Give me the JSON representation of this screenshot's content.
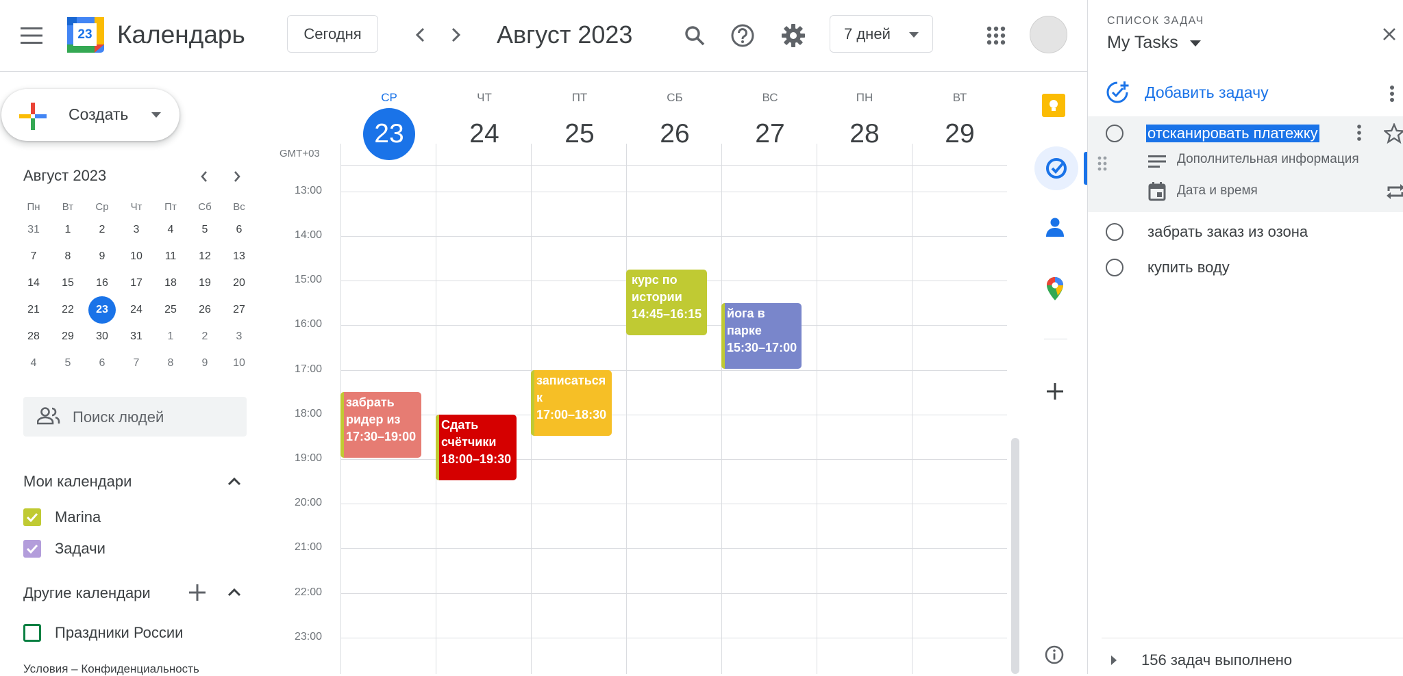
{
  "header": {
    "app_title": "Календарь",
    "logo_number": "23",
    "today_button": "Сегодня",
    "month_title": "Август 2023",
    "view_select": "7 дней"
  },
  "create_button": {
    "label": "Создать"
  },
  "mini_calendar": {
    "title": "Август 2023",
    "weekdays": [
      "Пн",
      "Вт",
      "Ср",
      "Чт",
      "Пт",
      "Сб",
      "Вс"
    ],
    "weeks": [
      [
        "31",
        "1",
        "2",
        "3",
        "4",
        "5",
        "6"
      ],
      [
        "7",
        "8",
        "9",
        "10",
        "11",
        "12",
        "13"
      ],
      [
        "14",
        "15",
        "16",
        "17",
        "18",
        "19",
        "20"
      ],
      [
        "21",
        "22",
        "23",
        "24",
        "25",
        "26",
        "27"
      ],
      [
        "28",
        "29",
        "30",
        "31",
        "1",
        "2",
        "3"
      ],
      [
        "4",
        "5",
        "6",
        "7",
        "8",
        "9",
        "10"
      ]
    ],
    "selected": "23"
  },
  "search_people": {
    "placeholder": "Поиск людей"
  },
  "my_calendars": {
    "title": "Мои календари",
    "items": [
      {
        "label": "Marina",
        "color": "#c0ca33"
      },
      {
        "label": "Задачи",
        "color": "#b39ddb"
      }
    ]
  },
  "other_calendars": {
    "title": "Другие календари",
    "items": [
      {
        "label": "Праздники России",
        "color": "#0b8043"
      }
    ]
  },
  "footer": {
    "text": "Условия – Конфиденциальность"
  },
  "week": {
    "timezone": "GMT+03",
    "days": [
      {
        "dow": "СР",
        "date": "23",
        "today": true
      },
      {
        "dow": "ЧТ",
        "date": "24"
      },
      {
        "dow": "ПТ",
        "date": "25"
      },
      {
        "dow": "СБ",
        "date": "26"
      },
      {
        "dow": "ВС",
        "date": "27"
      },
      {
        "dow": "ПН",
        "date": "28"
      },
      {
        "dow": "ВТ",
        "date": "29"
      }
    ],
    "hours": [
      "13:00",
      "14:00",
      "15:00",
      "16:00",
      "17:00",
      "18:00",
      "19:00",
      "20:00",
      "21:00",
      "22:00",
      "23:00"
    ],
    "events": [
      {
        "title_line1": "забрать",
        "title_line2": "ридер из",
        "time": "17:30–19:00",
        "color": "#e67c73"
      },
      {
        "title_line1": "Сдать",
        "title_line2": "счётчики",
        "time": "18:00–19:30",
        "color": "#d50000"
      },
      {
        "title_line1": "записаться",
        "title_line2": "к",
        "time": "17:00–18:30",
        "color": "#f6bf26"
      },
      {
        "title_line1": "курс по",
        "title_line2": "истории",
        "time": "14:45–16:15",
        "color": "#c0ca33"
      },
      {
        "title_line1": "йога в",
        "title_line2": "парке",
        "time": "15:30–17:00",
        "color": "#7986cb"
      }
    ]
  },
  "tasks_panel": {
    "label": "СПИСОК ЗАДАЧ",
    "list_name": "My Tasks",
    "add_task": "Добавить задачу",
    "tasks": [
      {
        "title": "отсканировать платежку",
        "details_placeholder": "Дополнительная информация",
        "date_placeholder": "Дата и время"
      },
      {
        "title": "забрать заказ из озона"
      },
      {
        "title": "купить воду"
      }
    ],
    "completed": "156 задач выполнено"
  }
}
